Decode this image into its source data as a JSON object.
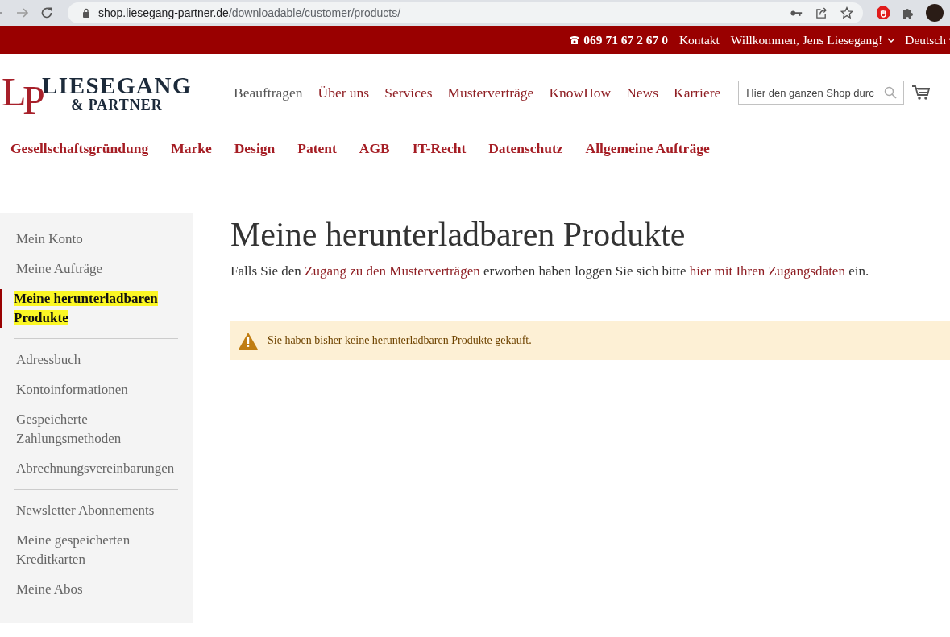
{
  "browser": {
    "url_host": "shop.liesegang-partner.de",
    "url_path": "/downloadable/customer/products/"
  },
  "top_bar": {
    "phone": "069 71 67 2 67 0",
    "contact": "Kontakt",
    "welcome": "Willkommen, Jens Liesegang!",
    "language": "Deutsch"
  },
  "logo": {
    "monogram_1": "L",
    "monogram_2": "P",
    "name": "LIESEGANG",
    "subtitle": "& PARTNER"
  },
  "main_nav": [
    {
      "label": "Beauftragen",
      "selected": true
    },
    {
      "label": "Über uns",
      "selected": false
    },
    {
      "label": "Services",
      "selected": false
    },
    {
      "label": "Musterverträge",
      "selected": false
    },
    {
      "label": "KnowHow",
      "selected": false
    },
    {
      "label": "News",
      "selected": false
    },
    {
      "label": "Karriere",
      "selected": false
    }
  ],
  "search": {
    "placeholder": "Hier den ganzen Shop durc"
  },
  "category_nav": [
    "Gesellschaftsgründung",
    "Marke",
    "Design",
    "Patent",
    "AGB",
    "IT-Recht",
    "Datenschutz",
    "Allgemeine Aufträge"
  ],
  "sidebar": {
    "groups": [
      [
        {
          "label": "Mein Konto",
          "selected": false
        },
        {
          "label": "Meine Aufträge",
          "selected": false
        },
        {
          "label": "Meine herunterladbaren Produkte",
          "selected": true
        }
      ],
      [
        {
          "label": "Adressbuch",
          "selected": false
        },
        {
          "label": "Kontoinformationen",
          "selected": false
        },
        {
          "label": "Gespeicherte Zahlungsmethoden",
          "selected": false
        },
        {
          "label": "Abrechnungsvereinbarungen",
          "selected": false
        }
      ],
      [
        {
          "label": "Newsletter Abonnements",
          "selected": false
        },
        {
          "label": "Meine gespeicherten Kreditkarten",
          "selected": false
        },
        {
          "label": "Meine Abos",
          "selected": false
        }
      ]
    ]
  },
  "page": {
    "title": "Meine herunterladbaren Produkte",
    "intro": [
      {
        "kind": "text",
        "text": "Falls Sie den "
      },
      {
        "kind": "link",
        "text": "Zugang zu den Musterverträgen"
      },
      {
        "kind": "text",
        "text": " erworben haben loggen Sie sich bitte "
      },
      {
        "kind": "link",
        "text": "hier mit Ihren Zugangsdaten"
      },
      {
        "kind": "text",
        "text": " ein."
      }
    ],
    "notice": "Sie haben bisher keine herunterladbaren Produkte gekauft."
  }
}
